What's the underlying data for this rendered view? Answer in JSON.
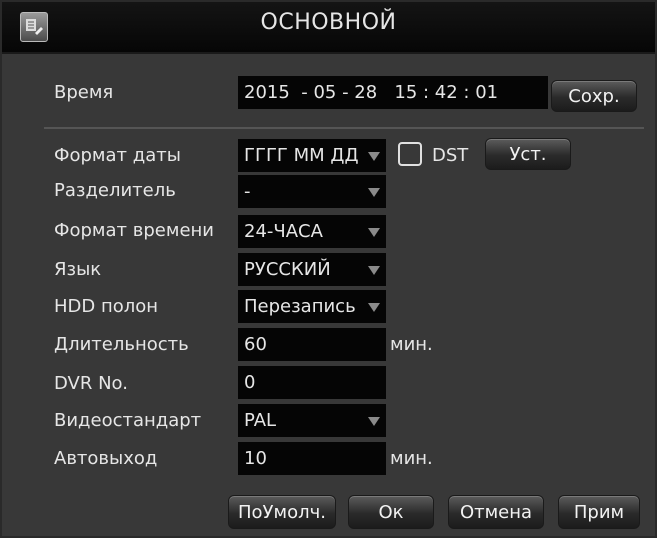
{
  "window": {
    "title": "ОСНОВНОЙ"
  },
  "time": {
    "label": "Время",
    "value": "2015  - 05 - 28   15 : 42 : 01",
    "save_button": "Сохр."
  },
  "settings": {
    "date_format": {
      "label": "Формат даты",
      "value": "ГГГГ ММ ДД",
      "dst_label": "DST",
      "set_button": "Уст."
    },
    "separator": {
      "label": "Разделитель",
      "value": "-"
    },
    "time_format": {
      "label": "Формат времени",
      "value": "24-ЧАСА"
    },
    "language": {
      "label": "Язык",
      "value": "РУССКИЙ"
    },
    "hdd_full": {
      "label": "HDD полон",
      "value": "Перезапись"
    },
    "duration": {
      "label": "Длительность",
      "value": "60",
      "unit": "мин."
    },
    "dvr_no": {
      "label": "DVR No.",
      "value": "0"
    },
    "video_standard": {
      "label": "Видеостандарт",
      "value": "PAL"
    },
    "auto_exit": {
      "label": "Автовыход",
      "value": "10",
      "unit": "мин."
    }
  },
  "footer": {
    "default_button": "ПоУмолч.",
    "ok_button": "Ок",
    "cancel_button": "Отмена",
    "apply_button": "Прим"
  },
  "dst_checked": false
}
